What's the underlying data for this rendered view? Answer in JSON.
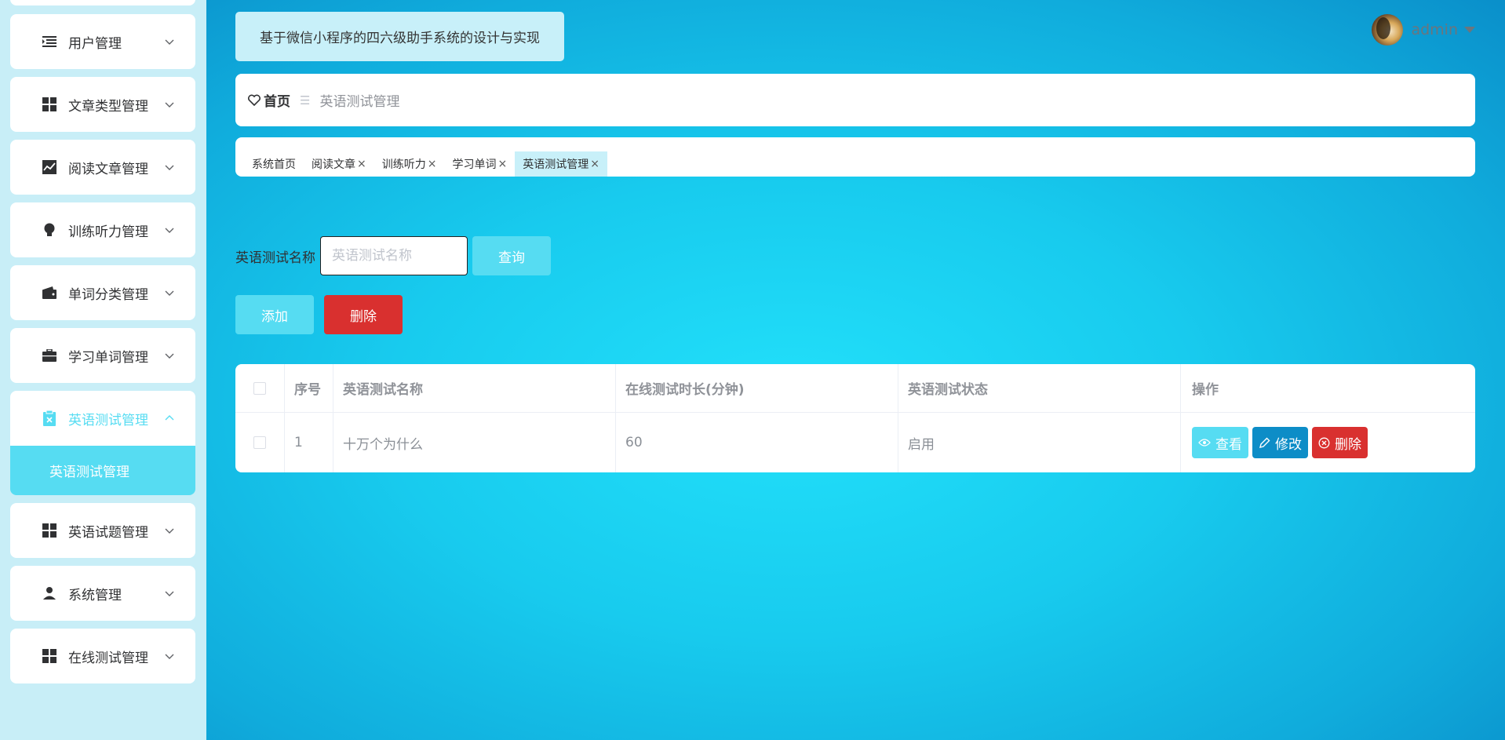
{
  "app": {
    "title": "基于微信小程序的四六级助手系统的设计与实现"
  },
  "user": {
    "name": "admin"
  },
  "sidebar": {
    "items": [
      {
        "label": "用户管理",
        "icon": "list-indent-icon"
      },
      {
        "label": "文章类型管理",
        "icon": "grid-icon"
      },
      {
        "label": "阅读文章管理",
        "icon": "chart-line-icon"
      },
      {
        "label": "训练听力管理",
        "icon": "bulb-icon"
      },
      {
        "label": "单词分类管理",
        "icon": "wallet-icon"
      },
      {
        "label": "学习单词管理",
        "icon": "briefcase-icon"
      },
      {
        "label": "英语测试管理",
        "icon": "clipboard-icon",
        "active": true
      },
      {
        "label": "英语试题管理",
        "icon": "grid-icon"
      },
      {
        "label": "系统管理",
        "icon": "user-icon"
      },
      {
        "label": "在线测试管理",
        "icon": "grid-icon"
      }
    ],
    "submenu": {
      "label": "英语测试管理"
    }
  },
  "breadcrumb": {
    "home": "首页",
    "separator": "☰",
    "current": "英语测试管理"
  },
  "tabs": [
    {
      "label": "系统首页",
      "closable": false
    },
    {
      "label": "阅读文章",
      "closable": true
    },
    {
      "label": "训练听力",
      "closable": true
    },
    {
      "label": "学习单词",
      "closable": true
    },
    {
      "label": "英语测试管理",
      "closable": true,
      "active": true
    }
  ],
  "tab_close_glyph": "×",
  "search": {
    "label": "英语测试名称",
    "placeholder": "英语测试名称",
    "value": "",
    "query_label": "查询"
  },
  "actions": {
    "add_label": "添加",
    "delete_label": "删除"
  },
  "table": {
    "columns": [
      "序号",
      "英语测试名称",
      "在线测试时长(分钟)",
      "英语测试状态",
      "操作"
    ],
    "rows": [
      {
        "index": "1",
        "name": "十万个为什么",
        "duration": "60",
        "status": "启用"
      }
    ],
    "row_actions": {
      "view": "查看",
      "edit": "修改",
      "delete": "删除"
    }
  },
  "colors": {
    "accent": "#56dcf2",
    "danger": "#d9302f",
    "edit": "#0d8dc7",
    "sidebar_bg": "#c8eef7"
  }
}
